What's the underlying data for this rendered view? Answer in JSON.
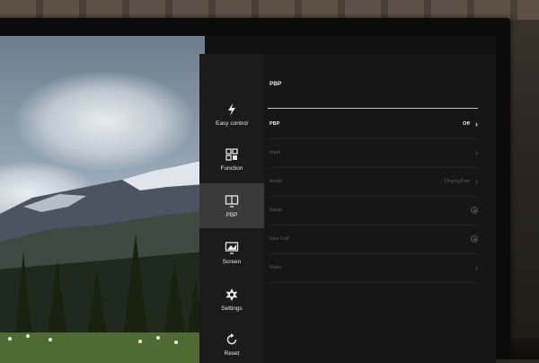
{
  "nav": {
    "items": [
      {
        "label": "Easy control",
        "icon": "lightning-icon"
      },
      {
        "label": "Function",
        "icon": "function-grid-icon"
      },
      {
        "label": "PBP",
        "icon": "pbp-monitor-icon",
        "active": true
      },
      {
        "label": "Screen",
        "icon": "screen-icon"
      },
      {
        "label": "Settings",
        "icon": "gear-icon"
      },
      {
        "label": "Reset",
        "icon": "reset-icon"
      }
    ]
  },
  "panel": {
    "title": "PBP",
    "rows": [
      {
        "label": "PBP",
        "value": "Off",
        "control": "chevron",
        "enabled": true
      },
      {
        "label": "Input",
        "value": "",
        "control": "chevron",
        "enabled": false
      },
      {
        "label": "Audio",
        "value": "DisplayPort",
        "control": "chevron",
        "enabled": false
      },
      {
        "label": "Swap",
        "value": "",
        "control": "radio",
        "enabled": false
      },
      {
        "label": "Size Full",
        "value": "",
        "control": "radio",
        "enabled": false
      },
      {
        "label": "Ratio",
        "value": "",
        "control": "chevron",
        "enabled": false
      }
    ]
  },
  "colors": {
    "nav_bg": "#1b1b1b",
    "nav_active": "#3a3a3a",
    "panel_bg": "#161616",
    "text_enabled": "#ececec",
    "text_disabled": "#5b5b5b"
  }
}
